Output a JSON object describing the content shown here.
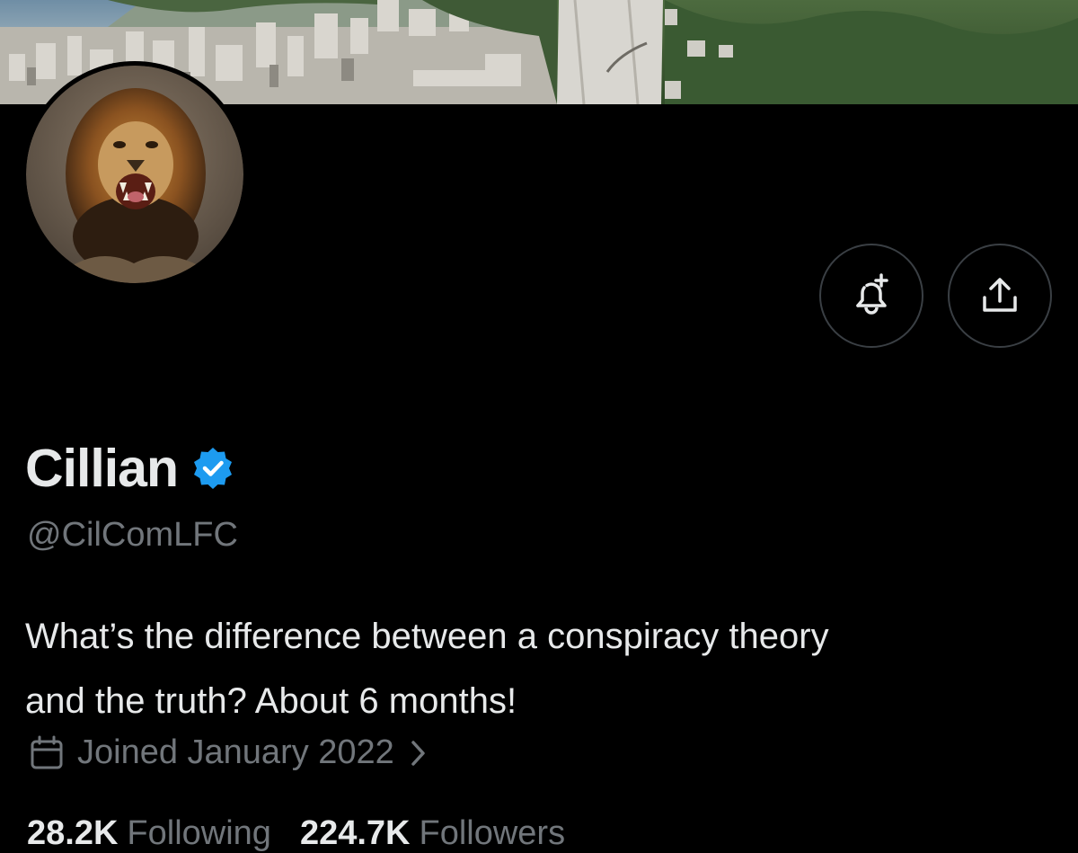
{
  "profile": {
    "display_name": "Cillian",
    "handle": "@CilComLFC",
    "bio_line_1": "What’s the difference between a conspiracy theory",
    "bio_line_2": "and the truth? About 6 months!",
    "joined": "Joined January 2022",
    "verified": true
  },
  "stats": {
    "following_count": "28.2K",
    "following_label": "Following",
    "followers_count": "224.7K",
    "followers_label": "Followers"
  },
  "actions": {
    "notify_icon": "bell-plus-icon",
    "share_icon": "share-upload-icon"
  },
  "colors": {
    "background": "#000000",
    "primary_text": "#e7e9ea",
    "secondary_text": "#71767b",
    "verified_blue": "#1d9bf0",
    "button_border": "#3a3f44"
  }
}
